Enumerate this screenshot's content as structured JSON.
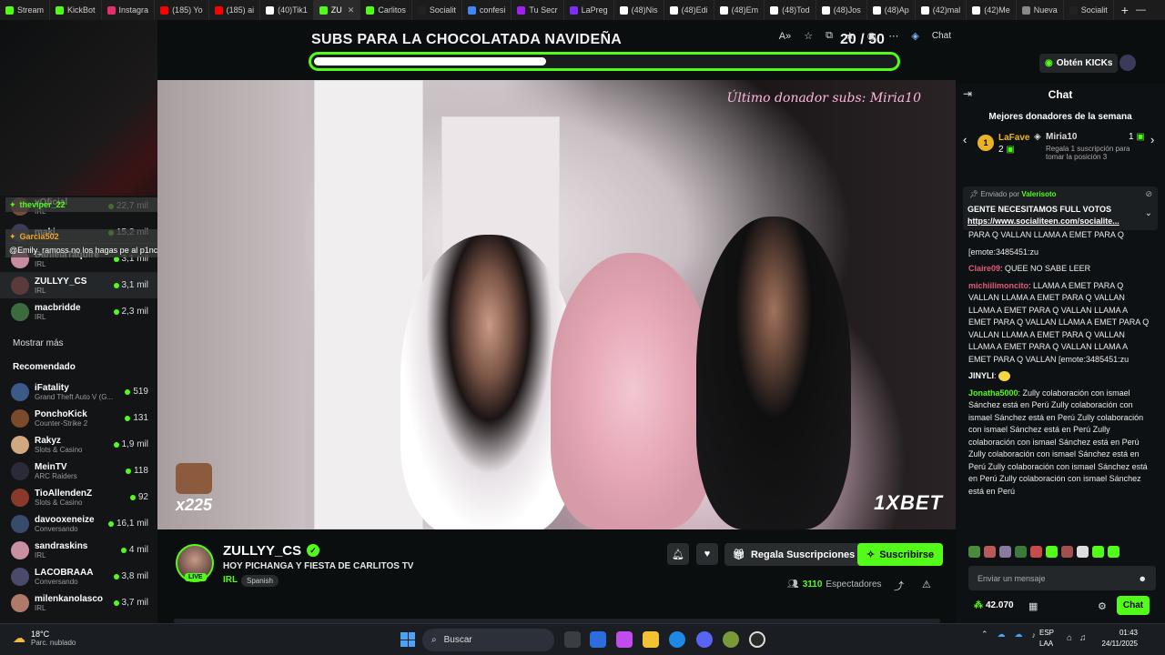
{
  "browser": {
    "tabs": [
      {
        "label": "Stream",
        "color": "#53fc18"
      },
      {
        "label": "KickBot",
        "color": "#53fc18"
      },
      {
        "label": "Instagra",
        "color": "#e1306c"
      },
      {
        "label": "(185) Yo",
        "color": "#ff0000"
      },
      {
        "label": "(185) ai",
        "color": "#ff0000"
      },
      {
        "label": "(40)Tik1",
        "color": "#ffffff"
      },
      {
        "label": "ZU",
        "color": "#53fc18",
        "active": true
      },
      {
        "label": "Carlitos",
        "color": "#53fc18"
      },
      {
        "label": "Socialit",
        "color": "#222222"
      },
      {
        "label": "confesi",
        "color": "#4285f4"
      },
      {
        "label": "Tu Secr",
        "color": "#a020f0"
      },
      {
        "label": "LaPreg",
        "color": "#7b2ff7"
      },
      {
        "label": "(48)Nis",
        "color": "#ffffff"
      },
      {
        "label": "(48)Edi",
        "color": "#ffffff"
      },
      {
        "label": "(48)Em",
        "color": "#ffffff"
      },
      {
        "label": "(48)Tod",
        "color": "#ffffff"
      },
      {
        "label": "(48)Jos",
        "color": "#ffffff"
      },
      {
        "label": "(48)Ap",
        "color": "#ffffff"
      },
      {
        "label": "(42)mal",
        "color": "#ffffff"
      },
      {
        "label": "(42)Me",
        "color": "#ffffff"
      },
      {
        "label": "Nueva",
        "color": "#888888"
      },
      {
        "label": "Socialit",
        "color": "#222222"
      }
    ],
    "new_tab": "+",
    "window_controls": [
      "—",
      "❐",
      "✕"
    ]
  },
  "goal": {
    "title": "SUBS PARA LA CHOCOLATADA NAVIDEÑA",
    "count": "20  / 50",
    "progress": 0.4
  },
  "overlay_chat": [
    {
      "user": "theviper_22",
      "text": "",
      "color": "green"
    },
    {
      "user": "Garcia502",
      "text": "",
      "color": "yellow"
    },
    {
      "user": "",
      "text": "@Emily_ramoss no los hagas pe al p1ncho el examen oeoeoeoe",
      "color": "none"
    }
  ],
  "sidebar": {
    "followed": [
      {
        "name": "vOficial",
        "category": "IRL",
        "viewers": "22,7 mil"
      },
      {
        "name": "maki",
        "category": "",
        "viewers": "15,2 mil"
      },
      {
        "name": "DanielaTaquire",
        "category": "IRL",
        "viewers": "3,1 mil"
      },
      {
        "name": "ZULLYY_CS",
        "category": "IRL",
        "viewers": "3,1 mil",
        "selected": true
      },
      {
        "name": "macbridde",
        "category": "IRL",
        "viewers": "2,3 mil"
      }
    ],
    "show_more": "Mostrar más",
    "recommended_title": "Recomendado",
    "recommended": [
      {
        "name": "iFatality",
        "category": "Grand Theft Auto V (G...",
        "viewers": "519"
      },
      {
        "name": "PonchoKick",
        "category": "Counter-Strike 2",
        "viewers": "131"
      },
      {
        "name": "Rakyz",
        "category": "Slots & Casino",
        "viewers": "1,9 mil"
      },
      {
        "name": "MeinTV",
        "category": "ARC Raiders",
        "viewers": "118"
      },
      {
        "name": "TioAllendenZ",
        "category": "Slots & Casino",
        "viewers": "92"
      },
      {
        "name": "davooxeneize",
        "category": "Conversando",
        "viewers": "16,1 mil"
      },
      {
        "name": "sandraskins",
        "category": "IRL",
        "viewers": "4 mil"
      },
      {
        "name": "LACOBRAAA",
        "category": "Conversando",
        "viewers": "3,8 mil"
      },
      {
        "name": "milenkanolasco",
        "category": "IRL",
        "viewers": "3,7 mil"
      }
    ]
  },
  "video": {
    "donor_tag": "Último donador subs: Miria10",
    "brand": "1XBET",
    "multiplier": "x225"
  },
  "stream": {
    "streamer": "ZULLYY_CS",
    "live": "LIVE",
    "title": "HOY PICHANGA Y FIESTA DE CARLITOS TV",
    "category": "IRL",
    "language": "Spanish",
    "gift_label": "Regala Suscripciones",
    "subscribe_label": "Suscribirse",
    "viewers": "3110",
    "viewers_label": "Espectadores"
  },
  "chat": {
    "kick_button": "Obtén KICKs",
    "title": "Chat",
    "donors_title": "Mejores donadores de la semana",
    "donor_first": {
      "name": "LaFave",
      "rank": "1",
      "amount": "2"
    },
    "donor_second": {
      "name": "Miria10",
      "amount": "1",
      "note": "Regala 1 suscripción para tomar la posición 3"
    },
    "pinned_by_label": "Enviado por",
    "pinned_by": "Valerisoto",
    "pinned_text": "GENTE NECESITAMOS FULL VOTOS",
    "pinned_link": "https://www.socialiteen.com/socialite...",
    "messages": [
      {
        "user": "",
        "text": "PARA Q VALLAN  LLAMA A EMET PARA Q",
        "color": "#ffffff"
      },
      {
        "user": "",
        "text": "[emote:3485451:zu",
        "color": "#ffffff"
      },
      {
        "user": "Claire09",
        "text": "QUEE NO SABE LEER",
        "color": "#e05a7a"
      },
      {
        "user": "michiilimoncito",
        "text": "LLAMA A EMET PARA Q VALLAN  LLAMA A EMET PARA Q VALLAN  LLAMA A EMET PARA Q VALLAN  LLAMA A EMET PARA Q VALLAN  LLAMA A EMET PARA Q VALLAN  LLAMA A EMET PARA Q VALLAN  LLAMA A EMET PARA Q VALLAN  LLAMA A EMET PARA Q VALLAN [emote:3485451:zu",
        "color": "#e05a7a"
      },
      {
        "user": "JINYLI",
        "text": "",
        "color": "#ffffff"
      },
      {
        "user": "Jonatha5000",
        "text": "Zully colaboración con ismael Sánchez está en Perú Zully colaboración con ismael Sánchez está en Perú Zully colaboración con ismael Sánchez está en Perú Zully colaboración con ismael Sánchez está en Perú Zully colaboración con ismael Sánchez está en Perú Zully colaboración con ismael Sánchez está en Perú Zully colaboración con ismael Sánchez está en Perú",
        "color": "#53fc18"
      }
    ],
    "input_placeholder": "Enviar un mensaje",
    "points": "42.070",
    "send_label": "Chat"
  },
  "taskbar": {
    "temp": "18°C",
    "weather": "Parc. nublado",
    "search": "Buscar",
    "lang_top": "ESP",
    "lang_bottom": "LAA",
    "time": "01:43",
    "date": "24/11/2025"
  }
}
